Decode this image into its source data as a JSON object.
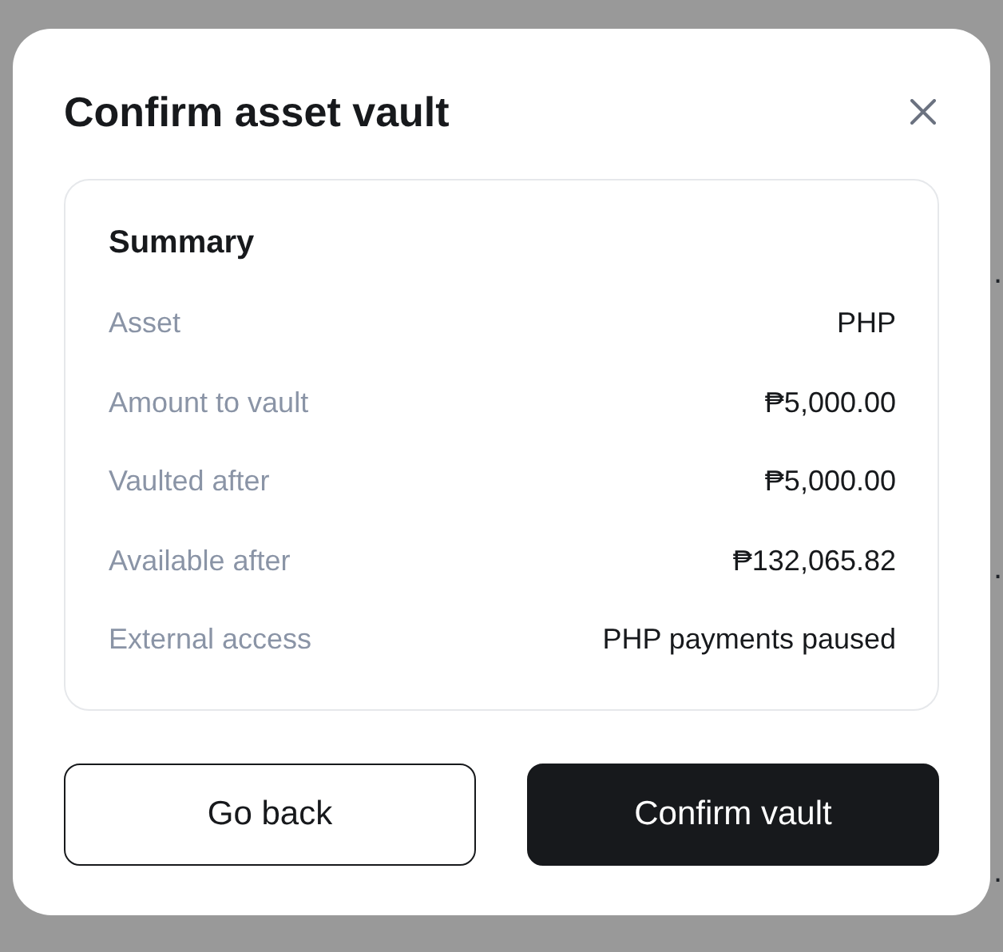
{
  "backdrop": {
    "fragments": [
      ".",
      ".",
      "."
    ]
  },
  "dialog": {
    "title": "Confirm asset vault",
    "summary": {
      "heading": "Summary",
      "rows": [
        {
          "label": "Asset",
          "value": "PHP"
        },
        {
          "label": "Amount to vault",
          "value": "₱5,000.00"
        },
        {
          "label": "Vaulted after",
          "value": "₱5,000.00"
        },
        {
          "label": "Available after",
          "value": "₱132,065.82"
        },
        {
          "label": "External access",
          "value": "PHP payments paused"
        }
      ]
    },
    "buttons": [
      {
        "label": "Go back",
        "kind": "secondary"
      },
      {
        "label": "Confirm vault",
        "kind": "primary"
      }
    ]
  }
}
